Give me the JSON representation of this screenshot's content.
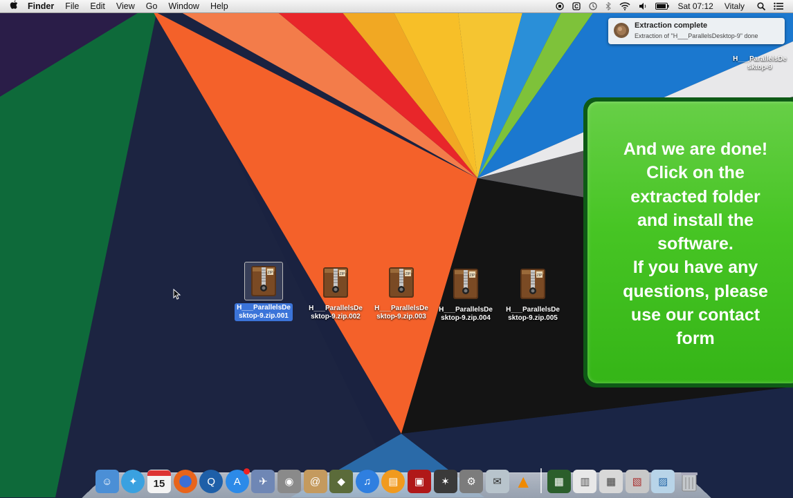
{
  "menubar": {
    "apple": "",
    "app_name": "Finder",
    "menus": [
      "File",
      "Edit",
      "View",
      "Go",
      "Window",
      "Help"
    ],
    "clock": "Sat 07:12",
    "user": "Vitaly",
    "status_icons": [
      "record-icon",
      "clipboard-icon",
      "time-machine-icon",
      "bluetooth-icon",
      "wifi-icon",
      "volume-icon",
      "battery-icon"
    ]
  },
  "notification": {
    "title": "Extraction complete",
    "body": "Extraction of \"H___ParallelsDesktop-9\" done"
  },
  "extracted_folder": {
    "line1": "H___ParallelsDe",
    "line2": "sktop-9"
  },
  "panel": {
    "lines": [
      "And we are done!",
      "Click on the",
      "extracted folder",
      "and install the",
      "software.",
      "If you have any",
      "questions, please",
      "use our contact",
      "form"
    ]
  },
  "desktop_files": [
    {
      "line1": "H___ParallelsDe",
      "line2": "sktop-9.zip.001",
      "selected": true
    },
    {
      "line1": "H___ParallelsDe",
      "line2": "sktop-9.zip.002",
      "selected": false
    },
    {
      "line1": "H___ParallelsDe",
      "line2": "sktop-9.zip.003",
      "selected": false
    },
    {
      "line1": "H___ParallelsDe",
      "line2": "sktop-9.zip.004",
      "selected": false
    },
    {
      "line1": "H___ParallelsDe",
      "line2": "sktop-9.zip.005",
      "selected": false
    }
  ],
  "calendar_day": "15",
  "dock": {
    "apps": [
      {
        "name": "finder-icon",
        "color": "#4b8fd6",
        "glyph": "☺"
      },
      {
        "name": "safari-icon",
        "color": "#3aa1e0",
        "glyph": "✦"
      },
      {
        "name": "calendar-icon",
        "color": "#f4f4f4",
        "glyph": ""
      },
      {
        "name": "firefox-icon",
        "color": "#e8641b",
        "glyph": "●"
      },
      {
        "name": "quicktime-icon",
        "color": "#1e5fa8",
        "glyph": "Q"
      },
      {
        "name": "app-store-icon",
        "color": "#2c8ae8",
        "glyph": "A"
      },
      {
        "name": "preview-icon",
        "color": "#6f87b5",
        "glyph": "✈"
      },
      {
        "name": "facetime-icon",
        "color": "#8a8a8a",
        "glyph": "◉"
      },
      {
        "name": "contacts-icon",
        "color": "#c49a5e",
        "glyph": "@"
      },
      {
        "name": "dashcode-icon",
        "color": "#5b6b3a",
        "glyph": "◆"
      },
      {
        "name": "itunes-icon",
        "color": "#2f7fe0",
        "glyph": "♫"
      },
      {
        "name": "ibooks-icon",
        "color": "#f19a1e",
        "glyph": "▤"
      },
      {
        "name": "photo-booth-icon",
        "color": "#b01818",
        "glyph": "▣"
      },
      {
        "name": "final-cut-icon",
        "color": "#3a3a3a",
        "glyph": "✶"
      },
      {
        "name": "system-preferences-icon",
        "color": "#7c7c7c",
        "glyph": "⚙"
      },
      {
        "name": "mail-icon",
        "color": "#b8c4cc",
        "glyph": "✉"
      },
      {
        "name": "vlc-icon",
        "color": "#f08a00",
        "glyph": "▲"
      }
    ],
    "stacks": [
      {
        "name": "activity-monitor-icon",
        "color": "#2b5e2b",
        "glyph": "▦"
      },
      {
        "name": "documents-stack-icon",
        "color": "#e8e8e8",
        "glyph": "▥"
      },
      {
        "name": "launchpad-grid-icon",
        "color": "#d8d8d8",
        "glyph": "▦"
      },
      {
        "name": "pictures-stack-icon",
        "color": "#c8c8c8",
        "glyph": "▧"
      },
      {
        "name": "downloads-stack-icon",
        "color": "#b8d4e8",
        "glyph": "▨"
      },
      {
        "name": "trash-icon",
        "color": "#c4c8cc",
        "glyph": "🗑"
      }
    ]
  }
}
